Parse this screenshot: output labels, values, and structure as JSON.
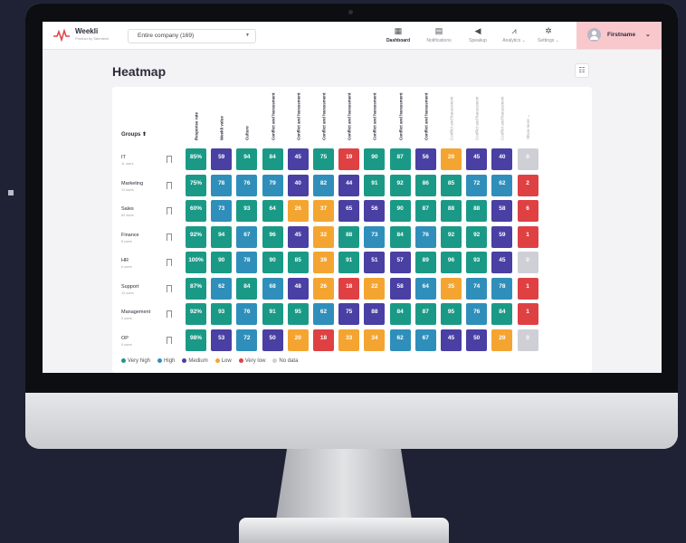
{
  "colors": {
    "very_high": "#1a9a86",
    "high": "#2f8fba",
    "medium": "#4a3fa3",
    "low": "#f4a531",
    "very_low": "#df4143",
    "no_data": "#cfcfd6"
  },
  "header": {
    "logo_name": "Weekli",
    "logo_sub": "Product by Talentech",
    "company_select": "Entire company (169)",
    "nav": [
      {
        "label": "Dashboard",
        "icon": "dashboard-icon"
      },
      {
        "label": "Notifications",
        "icon": "notifications-icon"
      },
      {
        "label": "Speakup",
        "icon": "megaphone-icon"
      },
      {
        "label": "Analytics ⌄",
        "icon": "analytics-icon"
      },
      {
        "label": "Settings ⌄",
        "icon": "gear-icon"
      }
    ],
    "user_name": "Firstname"
  },
  "page": {
    "title": "Heatmap"
  },
  "heatmap": {
    "groups_label": "Groups",
    "columns": [
      "Response rate",
      "Weekli value",
      "Culture",
      "Conflict and harassment",
      "Conflict and harassment",
      "Conflict and harassment",
      "Conflict and harassment",
      "Conflict and harassment",
      "Conflict and harassment",
      "Conflict and harassment",
      "Conflict and harassment",
      "Conflict and harassment",
      "Conflict and harassment",
      "Show more ⌄"
    ],
    "rows": [
      {
        "name": "IT",
        "sub": "11 users",
        "cells": [
          [
            "85%",
            "vh"
          ],
          [
            "59",
            "m"
          ],
          [
            "94",
            "vh"
          ],
          [
            "84",
            "vh"
          ],
          [
            "45",
            "m"
          ],
          [
            "75",
            "vh"
          ],
          [
            "19",
            "vl"
          ],
          [
            "90",
            "vh"
          ],
          [
            "87",
            "vh"
          ],
          [
            "56",
            "m"
          ],
          [
            "20",
            "l"
          ],
          [
            "45",
            "m"
          ],
          [
            "40",
            "m"
          ],
          [
            "0",
            "nd"
          ]
        ]
      },
      {
        "name": "Marketing",
        "sub": "13 users",
        "cells": [
          [
            "75%",
            "vh"
          ],
          [
            "78",
            "h"
          ],
          [
            "76",
            "h"
          ],
          [
            "79",
            "h"
          ],
          [
            "40",
            "m"
          ],
          [
            "82",
            "h"
          ],
          [
            "44",
            "m"
          ],
          [
            "91",
            "vh"
          ],
          [
            "92",
            "vh"
          ],
          [
            "86",
            "vh"
          ],
          [
            "85",
            "vh"
          ],
          [
            "72",
            "h"
          ],
          [
            "62",
            "h"
          ],
          [
            "2",
            "vl"
          ]
        ]
      },
      {
        "name": "Sales",
        "sub": "84 users",
        "cells": [
          [
            "60%",
            "vh"
          ],
          [
            "73",
            "h"
          ],
          [
            "93",
            "vh"
          ],
          [
            "64",
            "vh"
          ],
          [
            "26",
            "l"
          ],
          [
            "37",
            "l"
          ],
          [
            "65",
            "m"
          ],
          [
            "56",
            "m"
          ],
          [
            "90",
            "vh"
          ],
          [
            "87",
            "vh"
          ],
          [
            "88",
            "vh"
          ],
          [
            "88",
            "vh"
          ],
          [
            "58",
            "m"
          ],
          [
            "6",
            "vl"
          ]
        ]
      },
      {
        "name": "Finance",
        "sub": "8 users",
        "cells": [
          [
            "92%",
            "vh"
          ],
          [
            "94",
            "vh"
          ],
          [
            "67",
            "h"
          ],
          [
            "96",
            "vh"
          ],
          [
            "45",
            "m"
          ],
          [
            "32",
            "l"
          ],
          [
            "88",
            "vh"
          ],
          [
            "73",
            "h"
          ],
          [
            "84",
            "vh"
          ],
          [
            "76",
            "h"
          ],
          [
            "92",
            "vh"
          ],
          [
            "92",
            "vh"
          ],
          [
            "59",
            "m"
          ],
          [
            "1",
            "vl"
          ]
        ]
      },
      {
        "name": "HR",
        "sub": "6 users",
        "cells": [
          [
            "100%",
            "vh"
          ],
          [
            "90",
            "vh"
          ],
          [
            "78",
            "h"
          ],
          [
            "90",
            "vh"
          ],
          [
            "85",
            "vh"
          ],
          [
            "39",
            "l"
          ],
          [
            "91",
            "vh"
          ],
          [
            "51",
            "m"
          ],
          [
            "57",
            "m"
          ],
          [
            "89",
            "vh"
          ],
          [
            "96",
            "vh"
          ],
          [
            "93",
            "vh"
          ],
          [
            "45",
            "m"
          ],
          [
            "0",
            "nd"
          ]
        ]
      },
      {
        "name": "Support",
        "sub": "13 users",
        "cells": [
          [
            "87%",
            "vh"
          ],
          [
            "62",
            "h"
          ],
          [
            "84",
            "vh"
          ],
          [
            "68",
            "h"
          ],
          [
            "48",
            "m"
          ],
          [
            "26",
            "l"
          ],
          [
            "18",
            "vl"
          ],
          [
            "22",
            "l"
          ],
          [
            "58",
            "m"
          ],
          [
            "64",
            "h"
          ],
          [
            "35",
            "l"
          ],
          [
            "74",
            "h"
          ],
          [
            "78",
            "h"
          ],
          [
            "1",
            "vl"
          ]
        ]
      },
      {
        "name": "Management",
        "sub": "5 users",
        "cells": [
          [
            "92%",
            "vh"
          ],
          [
            "93",
            "vh"
          ],
          [
            "76",
            "h"
          ],
          [
            "91",
            "vh"
          ],
          [
            "95",
            "vh"
          ],
          [
            "62",
            "h"
          ],
          [
            "75",
            "m"
          ],
          [
            "88",
            "m"
          ],
          [
            "84",
            "vh"
          ],
          [
            "87",
            "vh"
          ],
          [
            "95",
            "vh"
          ],
          [
            "76",
            "h"
          ],
          [
            "84",
            "vh"
          ],
          [
            "1",
            "vl"
          ]
        ]
      },
      {
        "name": "OP",
        "sub": "9 users",
        "cells": [
          [
            "98%",
            "vh"
          ],
          [
            "53",
            "m"
          ],
          [
            "72",
            "h"
          ],
          [
            "50",
            "m"
          ],
          [
            "20",
            "l"
          ],
          [
            "18",
            "vl"
          ],
          [
            "33",
            "l"
          ],
          [
            "34",
            "l"
          ],
          [
            "62",
            "h"
          ],
          [
            "67",
            "h"
          ],
          [
            "45",
            "m"
          ],
          [
            "50",
            "m"
          ],
          [
            "29",
            "l"
          ],
          [
            "0",
            "nd"
          ]
        ]
      }
    ]
  },
  "legend": [
    {
      "label": "Very high",
      "key": "vh"
    },
    {
      "label": "High",
      "key": "h"
    },
    {
      "label": "Medium",
      "key": "m"
    },
    {
      "label": "Low",
      "key": "l"
    },
    {
      "label": "Very low",
      "key": "vl"
    },
    {
      "label": "No data",
      "key": "nd"
    }
  ]
}
